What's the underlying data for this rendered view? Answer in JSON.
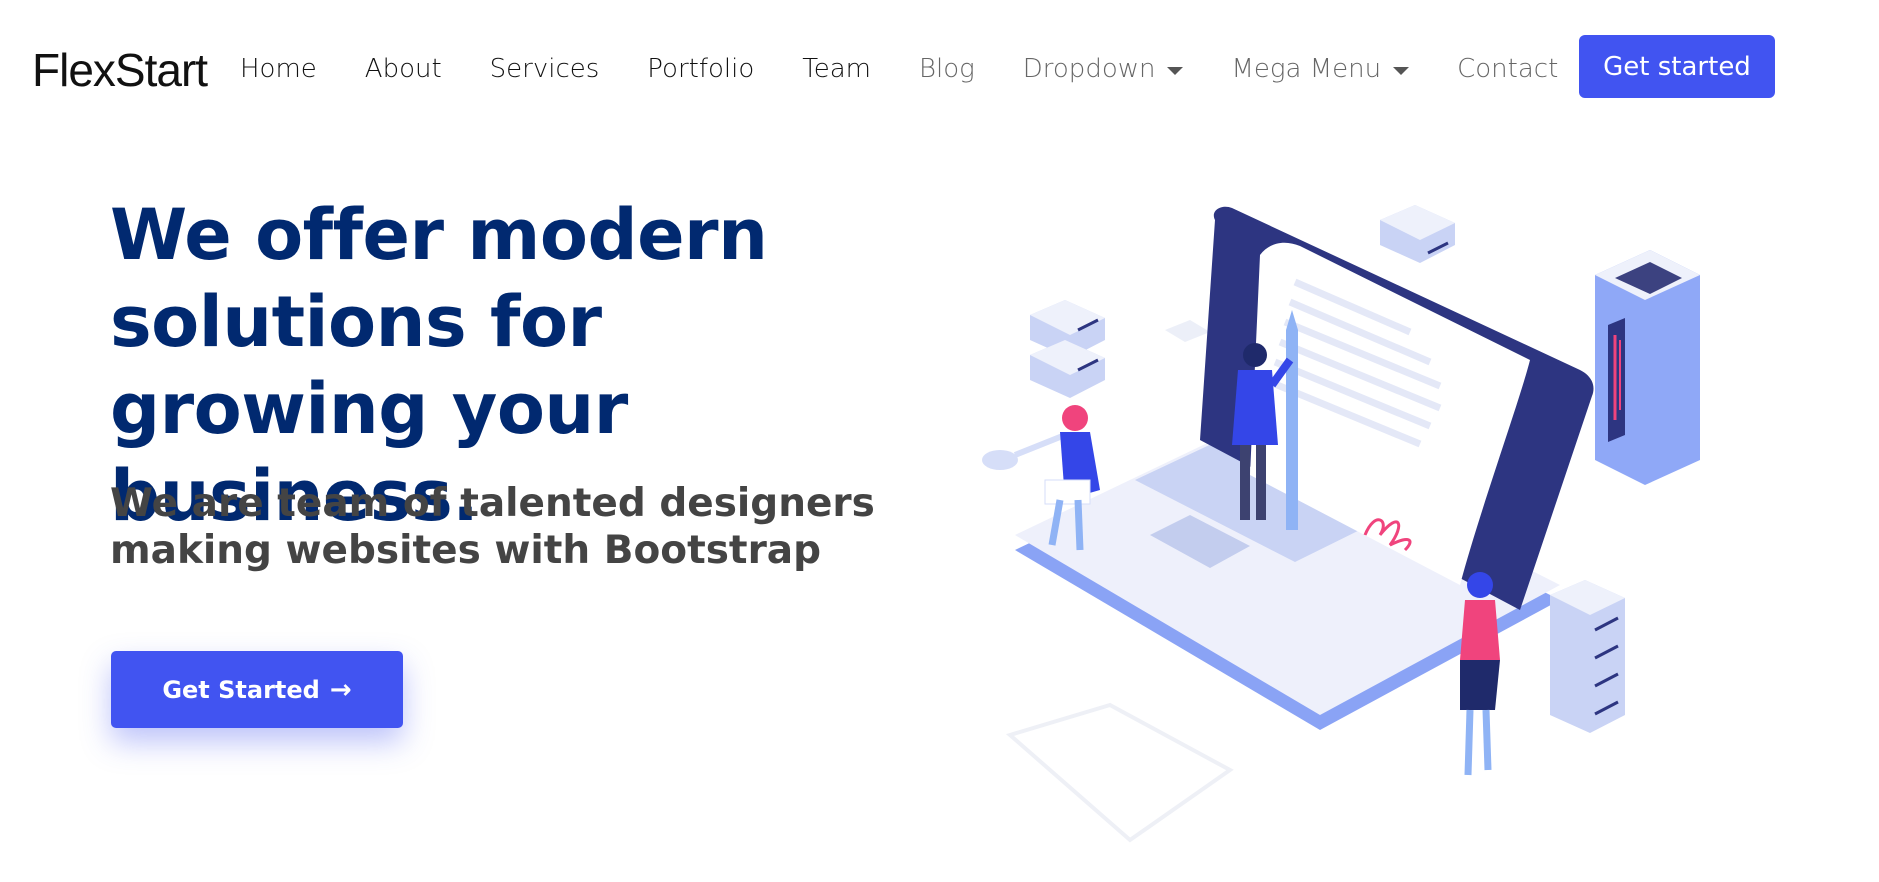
{
  "header": {
    "logo": "FlexStart",
    "nav": [
      {
        "label": "Home",
        "dropdown": false
      },
      {
        "label": "About",
        "dropdown": false
      },
      {
        "label": "Services",
        "dropdown": false
      },
      {
        "label": "Portfolio",
        "dropdown": false
      },
      {
        "label": "Team",
        "dropdown": false
      },
      {
        "label": "Blog",
        "dropdown": false
      },
      {
        "label": "Dropdown",
        "dropdown": true
      },
      {
        "label": "Mega Menu",
        "dropdown": true
      },
      {
        "label": "Contact",
        "dropdown": false
      }
    ],
    "cta_label": "Get started"
  },
  "hero": {
    "title": "We offer modern solutions for growing your business.",
    "subtitle": "We are team of talented designers making websites with Bootstrap",
    "button_label": "Get Started",
    "button_icon": "arrow-right-icon"
  },
  "colors": {
    "accent": "#4154f1",
    "heading": "#012970",
    "subtitle": "#444444"
  }
}
